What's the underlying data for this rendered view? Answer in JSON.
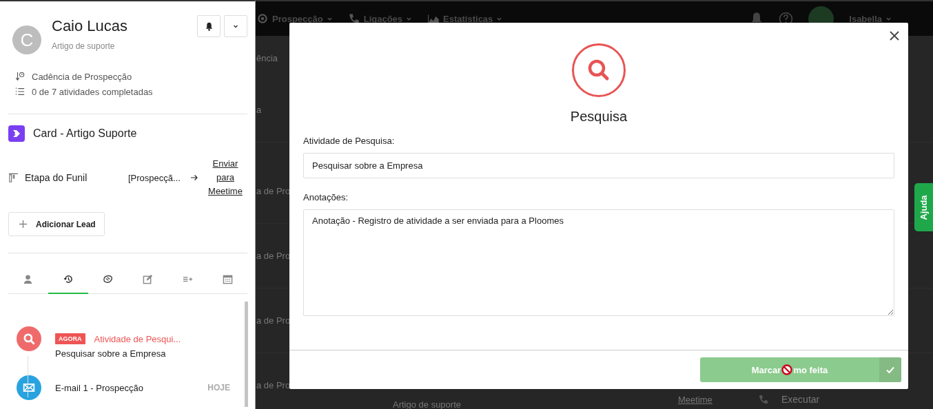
{
  "background": {
    "nav": [
      {
        "label": "Prospecção",
        "kind": "target"
      },
      {
        "label": "Ligações",
        "kind": "phone"
      },
      {
        "label": "Estatísticas",
        "kind": "chart"
      }
    ],
    "user": {
      "name": "Isabella"
    },
    "breadcrumb": "ência",
    "rows": [
      "a",
      "a de Pro",
      "a de Pro",
      "a de Pro",
      "a de Pro"
    ],
    "last_row": {
      "subtitle": "Artigo de suporte",
      "link": "Meetime",
      "action": "Executar"
    }
  },
  "drawer": {
    "contact": {
      "initial": "C",
      "name": "Caio Lucas",
      "subtitle": "Artigo de suporte"
    },
    "cadence": "Cadência de Prospecção",
    "progress": "0 de 7 atividades completadas",
    "card": {
      "title": "Card - Artigo Suporte",
      "stage_label": "Etapa do Funil",
      "stage_value": "[Prospecçã...",
      "send_link": "Enviar para Meetime"
    },
    "add_lead": "Adicionar Lead",
    "tabs": [
      {
        "kind": "person",
        "selected": false
      },
      {
        "kind": "history",
        "selected": true
      },
      {
        "kind": "deal",
        "selected": false
      },
      {
        "kind": "edit",
        "selected": false
      },
      {
        "kind": "listadd",
        "selected": false
      },
      {
        "kind": "calendar",
        "selected": false
      }
    ],
    "timeline": [
      {
        "kind": "research",
        "badge": "AGORA",
        "title": "Atividade de Pesqui...",
        "detail": "Pesquisar sobre a Empresa"
      },
      {
        "kind": "email",
        "title": "E-mail 1 - Prospecção",
        "date": "HOJE"
      }
    ]
  },
  "modal": {
    "title": "Pesquisa",
    "activity_label": "Atividade de Pesquisa:",
    "activity_value": "Pesquisar sobre a Empresa",
    "notes_label": "Anotações:",
    "notes_value": "Anotação - Registro de atividade a ser enviada para a Ploomes",
    "done_button": {
      "before": "Marcar",
      "after": "mo feita"
    }
  },
  "help_tab": "Ajuda"
}
